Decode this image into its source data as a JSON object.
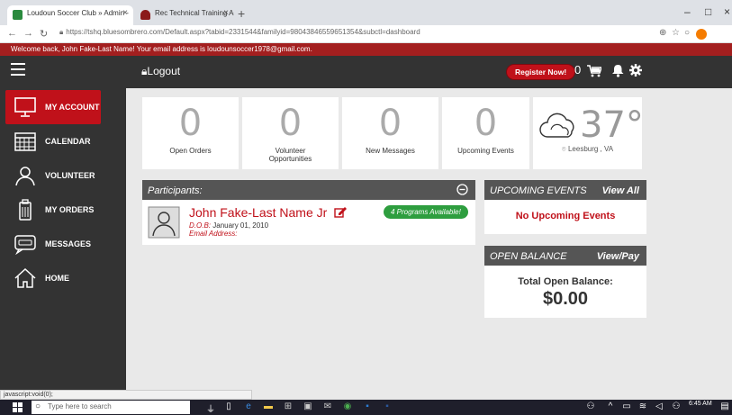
{
  "browser": {
    "tabs": [
      {
        "label": "Loudoun Soccer Club » Admin -",
        "active": true
      },
      {
        "label": "Rec Technical Training Academy",
        "active": false
      }
    ],
    "url": "https://tshq.bluesombrero.com/Default.aspx?tabid=2331544&familyid=98043846559651354&subctl=dashboard"
  },
  "welcome_text": "Welcome back, John Fake-Last Name! Your email address is loudounsoccer1978@gmail.com.",
  "header": {
    "logout_label": "Logout",
    "register_label": "Register Now!",
    "cart_count": "0"
  },
  "sidebar": {
    "items": [
      {
        "label": "MY ACCOUNT",
        "icon": "monitor-icon"
      },
      {
        "label": "CALENDAR",
        "icon": "calendar-icon"
      },
      {
        "label": "VOLUNTEER",
        "icon": "person-icon"
      },
      {
        "label": "MY ORDERS",
        "icon": "clipboard-icon"
      },
      {
        "label": "MESSAGES",
        "icon": "chat-icon"
      },
      {
        "label": "HOME",
        "icon": "house-icon"
      }
    ]
  },
  "stats": [
    {
      "value": "0",
      "label": "Open Orders"
    },
    {
      "value": "0",
      "label": "Volunteer Opportunities"
    },
    {
      "value": "0",
      "label": "New Messages"
    },
    {
      "value": "0",
      "label": "Upcoming Events"
    }
  ],
  "weather": {
    "temp": "37°",
    "location": "Leesburg , VA"
  },
  "participants": {
    "title": "Participants:",
    "name": "John Fake-Last Name Jr",
    "dob_label": "D.O.B:",
    "dob": "January 01, 2010",
    "email_label": "Email Address:",
    "programs_badge": "4 Programs Available!"
  },
  "upcoming_events": {
    "title": "UPCOMING EVENTS",
    "action": "View All",
    "empty_text": "No Upcoming Events"
  },
  "open_balance": {
    "title": "OPEN BALANCE",
    "action": "View/Pay",
    "label": "Total Open Balance:",
    "amount": "$0.00"
  },
  "status_bar": "javascript:void(0);",
  "taskbar": {
    "search_placeholder": "Type here to search",
    "time": "6:45 AM"
  },
  "colors": {
    "brand_red": "#c0111a",
    "dark_header": "#333333",
    "panel_head": "#555555",
    "badge_green": "#2e9e3f"
  }
}
